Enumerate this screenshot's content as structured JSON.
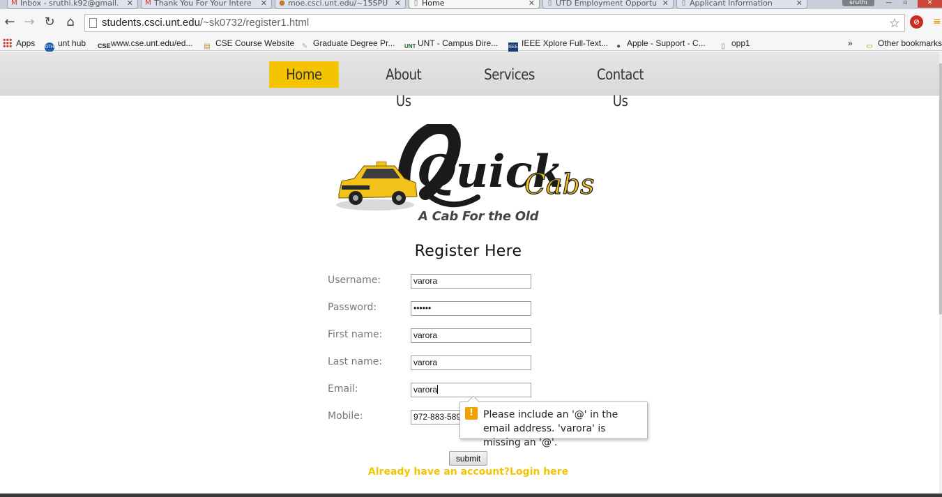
{
  "browser": {
    "tabs": [
      {
        "title": "Inbox - sruthi.k92@gmail.",
        "icon": "gmail-icon",
        "active": false
      },
      {
        "title": "Thank You For Your Intere",
        "icon": "gmail-icon",
        "active": false
      },
      {
        "title": "moe.csci.unt.edu/~15SPU",
        "icon": "web-icon",
        "active": false
      },
      {
        "title": "Home",
        "icon": "page-icon",
        "active": true
      },
      {
        "title": "UTD Employment Opportu",
        "icon": "page-icon",
        "active": false
      },
      {
        "title": "Applicant Information",
        "icon": "page-icon",
        "active": false
      }
    ],
    "profile_name": "sruthi",
    "url_host": "students.csci.unt.edu",
    "url_path": "/~sk0732/register1.html",
    "bookmarks": [
      {
        "label": "Apps",
        "icon": "apps-grid-icon"
      },
      {
        "label": "unt hub",
        "icon": "unt-hub-icon"
      },
      {
        "label": "www.cse.unt.edu/ed...",
        "icon": "cse-icon"
      },
      {
        "label": "CSE Course Website",
        "icon": "folder-icon"
      },
      {
        "label": "Graduate Degree Pr...",
        "icon": "feather-icon"
      },
      {
        "label": "UNT - Campus Dire...",
        "icon": "unt-icon"
      },
      {
        "label": "IEEE Xplore Full-Text...",
        "icon": "ieee-icon"
      },
      {
        "label": "Apple - Support - C...",
        "icon": "apple-icon"
      },
      {
        "label": "opp1",
        "icon": "page-icon"
      }
    ],
    "bookmarks_overflow": "»",
    "other_bookmarks": "Other bookmarks"
  },
  "nav": {
    "items": [
      {
        "label": "Home",
        "active": true
      },
      {
        "label": "About Us",
        "active": false
      },
      {
        "label": "Services",
        "active": false
      },
      {
        "label": "Contact Us",
        "active": false
      }
    ]
  },
  "logo": {
    "wordmark": "Quick",
    "wordmark2": "Cabs",
    "tagline": "A Cab For the Old"
  },
  "form": {
    "title": "Register Here",
    "fields": [
      {
        "label": "Username:",
        "value": "varora"
      },
      {
        "label": "Password:",
        "value": "••••••"
      },
      {
        "label": "First name:",
        "value": "varora"
      },
      {
        "label": "Last name:",
        "value": "varora"
      },
      {
        "label": "Email:",
        "value": "varora"
      },
      {
        "label": "Mobile:",
        "value": "972-883-589"
      }
    ],
    "submit_label": "submit",
    "login_link": "Already have an account?Login here"
  },
  "validation_tooltip": {
    "icon": "warning-icon",
    "message": "Please include an '@' in the email address. 'varora' is missing an '@'."
  },
  "colors": {
    "accent": "#f5c400",
    "nav_bg": "#e0e0e0",
    "warning": "#f2a100"
  }
}
